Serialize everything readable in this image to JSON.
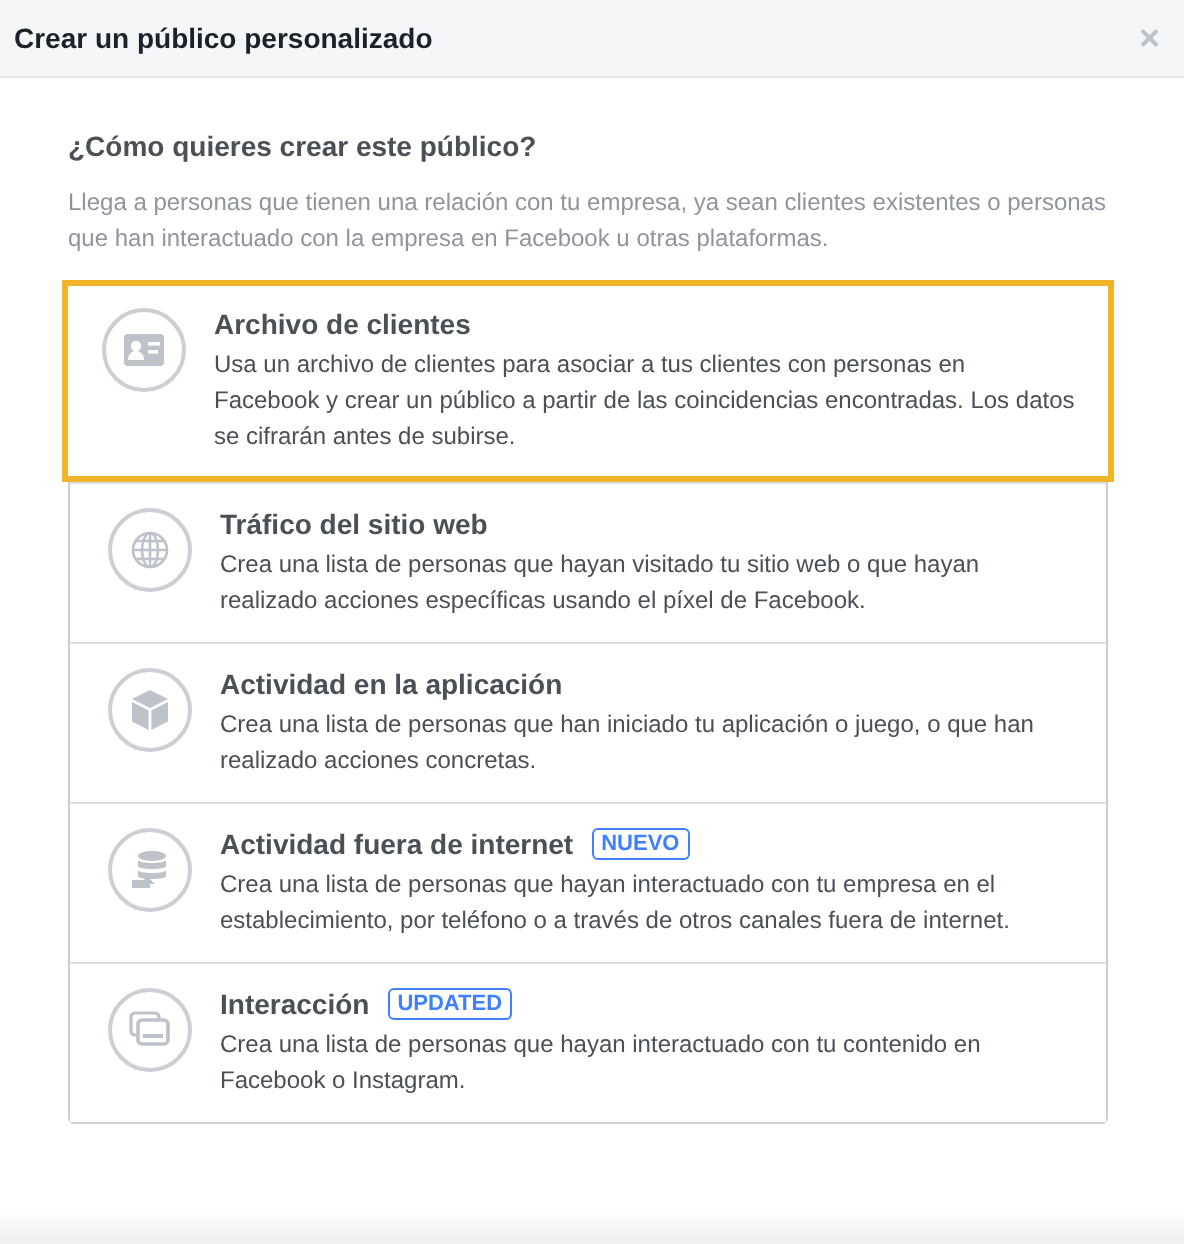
{
  "window": {
    "title": "Crear un público personalizado",
    "close": "×"
  },
  "heading": "¿Cómo quieres crear este público?",
  "intro": "Llega a personas que tienen una relación con tu empresa, ya sean clientes existentes o personas que han interactuado con la empresa en Facebook u otras plataformas.",
  "options": [
    {
      "title": "Archivo de clientes",
      "description": "Usa un archivo de clientes para asociar a tus clientes con personas en Facebook y crear un público a partir de las coincidencias encontradas. Los datos se cifrarán antes de subirse.",
      "selected": true
    },
    {
      "title": "Tráfico del sitio web",
      "description": "Crea una lista de personas que hayan visitado tu sitio web o que hayan realizado acciones específicas usando el píxel de Facebook.",
      "selected": false
    },
    {
      "title": "Actividad en la aplicación",
      "description": "Crea una lista de personas que han iniciado tu aplicación o juego, o que han realizado acciones concretas.",
      "selected": false
    },
    {
      "title": "Actividad fuera de internet",
      "badge": "NUEVO",
      "description": "Crea una lista de personas que hayan interactuado con tu empresa en el establecimiento, por teléfono o a través de otros canales fuera de internet.",
      "selected": false
    },
    {
      "title": "Interacción",
      "badge": "UPDATED",
      "description": "Crea una lista de personas que hayan interactuado con tu contenido en Facebook o Instagram.",
      "selected": false
    }
  ]
}
